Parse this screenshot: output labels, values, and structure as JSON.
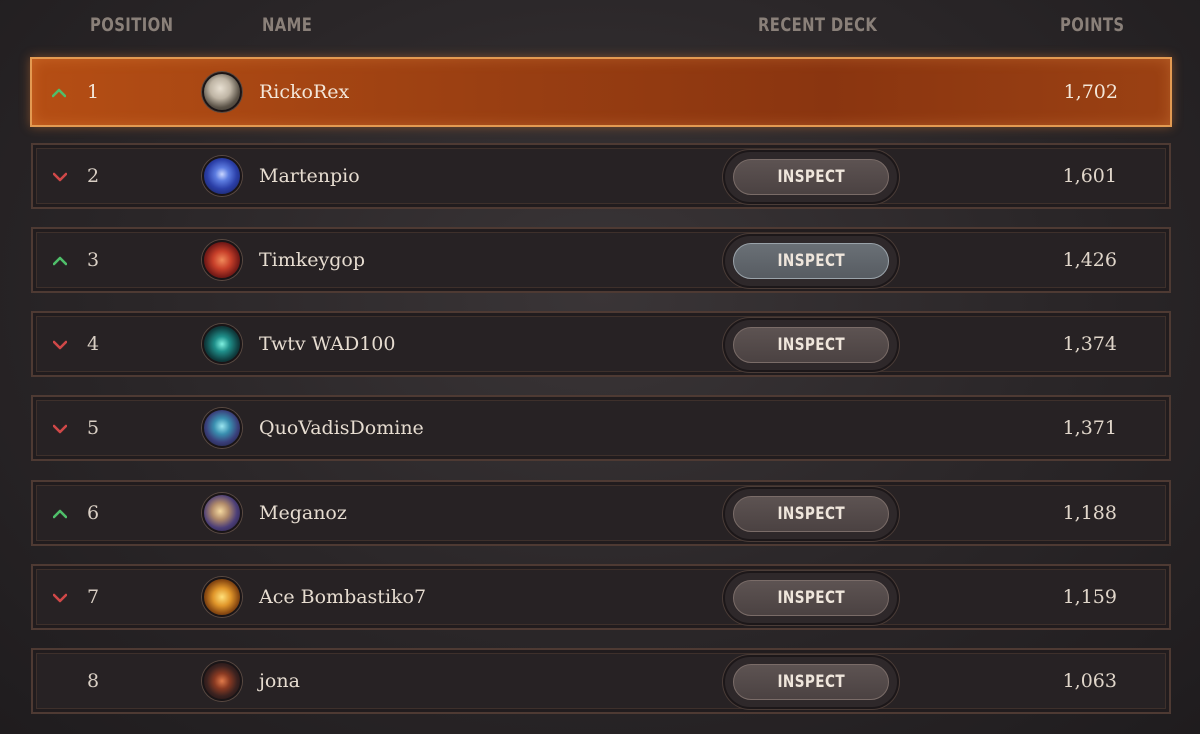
{
  "columns": {
    "position": "POSITION",
    "name": "NAME",
    "recent_deck": "RECENT DECK",
    "points": "POINTS"
  },
  "colors": {
    "up": "#4fbf6a",
    "down": "#d04848",
    "accent": "#b54e14"
  },
  "rows": [
    {
      "position": "1",
      "trend": "up",
      "name": "RickoRex",
      "points": "1,702",
      "inspect": "",
      "avatar": "dinosaur-avatar"
    },
    {
      "position": "2",
      "trend": "down",
      "name": "Martenpio",
      "points": "1,601",
      "inspect": "INSPECT",
      "avatar": "trophy-avatar"
    },
    {
      "position": "3",
      "trend": "up",
      "name": "Timkeygop",
      "points": "1,426",
      "inspect": "INSPECT",
      "avatar": "red-hair-avatar"
    },
    {
      "position": "4",
      "trend": "down",
      "name": "Twtv WAD100",
      "points": "1,374",
      "inspect": "INSPECT",
      "avatar": "teal-spirit-avatar"
    },
    {
      "position": "5",
      "trend": "down",
      "name": "QuoVadisDomine",
      "points": "1,371",
      "inspect": "",
      "avatar": "yordle-avatar"
    },
    {
      "position": "6",
      "trend": "up",
      "name": "Meganoz",
      "points": "1,188",
      "inspect": "INSPECT",
      "avatar": "champion-avatar"
    },
    {
      "position": "7",
      "trend": "down",
      "name": "Ace Bombastiko7",
      "points": "1,159",
      "inspect": "INSPECT",
      "avatar": "ziggs-avatar"
    },
    {
      "position": "8",
      "trend": "",
      "name": "jona",
      "points": "1,063",
      "inspect": "INSPECT",
      "avatar": "dark-knight-avatar"
    }
  ]
}
